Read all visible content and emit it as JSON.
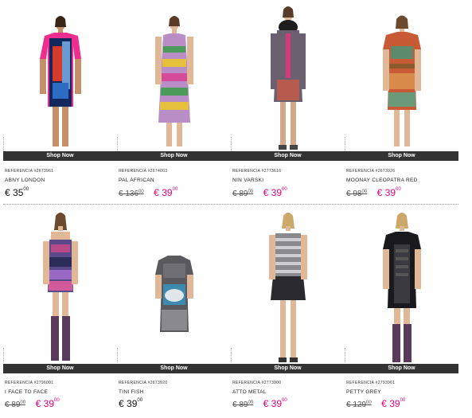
{
  "shop_label": "Shop Now",
  "currency": "€",
  "products": [
    {
      "ref": "REFERENCIA #2673961",
      "name": "ABNY LONDON",
      "old_int": "",
      "old_dec": "",
      "price_int": "35",
      "price_dec": "00",
      "on_sale": false
    },
    {
      "ref": "REFERENCIA #2674003",
      "name": "PAL AFRICAN",
      "old_int": "136",
      "old_dec": "00",
      "price_int": "39",
      "price_dec": "00",
      "on_sale": true
    },
    {
      "ref": "REFERENCIA #2773616",
      "name": "NIN VARSKI",
      "old_int": "89",
      "old_dec": "00",
      "price_int": "39",
      "price_dec": "00",
      "on_sale": true
    },
    {
      "ref": "REFERENCIA #2673926",
      "name": "MOONAY CLEOPATRA RED",
      "old_int": "98",
      "old_dec": "00",
      "price_int": "39",
      "price_dec": "00",
      "on_sale": true
    },
    {
      "ref": "REFERENCIA #2796001",
      "name": "I FACE TO FACE",
      "old_int": "89",
      "old_dec": "00",
      "price_int": "39",
      "price_dec": "00",
      "on_sale": true
    },
    {
      "ref": "REFERENCIA #2673920",
      "name": "TINI FISH",
      "old_int": "",
      "old_dec": "",
      "price_int": "39",
      "price_dec": "00",
      "on_sale": false
    },
    {
      "ref": "REFERENCIA #2773900",
      "name": "ATTO METAL",
      "old_int": "89",
      "old_dec": "00",
      "price_int": "39",
      "price_dec": "00",
      "on_sale": true
    },
    {
      "ref": "REFERENCIA #2793961",
      "name": "PETTY GREY",
      "old_int": "129",
      "old_dec": "00",
      "price_int": "39",
      "price_dec": "00",
      "on_sale": true
    }
  ],
  "colors": {
    "accent": "#e2007a",
    "button_bg": "#333333",
    "button_text": "#ffffff"
  }
}
